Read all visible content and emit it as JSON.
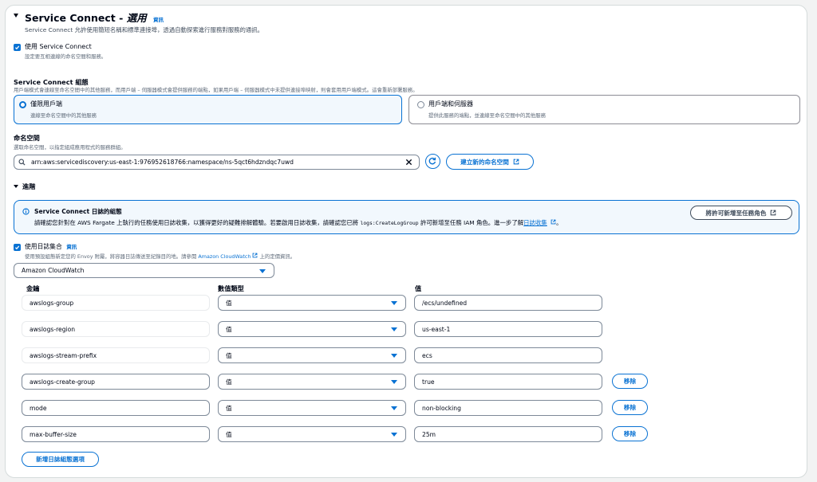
{
  "service_connect": {
    "title": "Service Connect - ",
    "title_italic": "選用",
    "info": "資訊",
    "description": "Service Connect 允許使用簡短名稱和標準連接埠，透過自動探索進行服務對服務的通訊。",
    "use_checkbox_label": "使用 Service Connect",
    "use_checkbox_desc": "設定要互相連線的命名空間和服務。"
  },
  "config": {
    "label": "Service Connect 組態",
    "description": "用戶端模式會連線至命名空間中的其他服務，而用戶端 – 伺服器模式會提供服務的端點，如果用戶端 – 伺服器模式中未提供連接埠映射，則會套用用戶端模式。這會重新部署服務。",
    "option_client": {
      "title": "僅限用戶端",
      "desc": "連線至命名空間中的其他服務"
    },
    "option_client_server": {
      "title": "用戶端和伺服器",
      "desc": "提供此服務的端點，並連線至命名空間中的其他服務"
    }
  },
  "namespace": {
    "label": "命名空間",
    "description": "選取命名空間，以指定組成應用程式的服務群組。",
    "value": "arn:aws:servicediscovery:us-east-1:976952618766:namespace/ns-5qct6hdzndqc7uwd",
    "create_button": "建立新的命名空間"
  },
  "advanced": {
    "label": "進階",
    "alert_title": "Service Connect 日誌的組態",
    "alert_text_1": "請確認您針對在 AWS Fargate 上執行的任務使用日誌收集，以獲得更好的疑難排解體驗。若要啟用日誌收集，請確認您已將 ",
    "alert_code": "logs:CreateLogGroup",
    "alert_text_2": " 許可新增至任務 IAM 角色。進一步了解",
    "alert_link": "日誌收集",
    "alert_end": "。",
    "alert_button": "將許可新增至任務角色"
  },
  "log_collection": {
    "checkbox_label": "使用日誌集合",
    "info": "資訊",
    "description_1": "使用預設組態新定您的 Envoy 附屬，將容器日誌傳送至紀錄目的地。請參閱 ",
    "description_link": "Amazon CloudWatch",
    "description_2": " 上的定價資訊。",
    "driver": "Amazon CloudWatch",
    "col_key": "金鑰",
    "col_type": "數值類型",
    "col_value": "值",
    "remove_label": "移除",
    "add_button": "新增日誌組態選項",
    "rows": [
      {
        "key": "awslogs-group",
        "type": "值",
        "value": "/ecs/undefined"
      },
      {
        "key": "awslogs-region",
        "type": "值",
        "value": "us-east-1"
      },
      {
        "key": "awslogs-stream-prefix",
        "type": "值",
        "value": "ecs"
      },
      {
        "key": "awslogs-create-group",
        "type": "值",
        "value": "true"
      },
      {
        "key": "mode",
        "type": "值",
        "value": "non-blocking"
      },
      {
        "key": "max-buffer-size",
        "type": "值",
        "value": "25m"
      }
    ]
  },
  "colors": {
    "accent": "#0972d3",
    "text": "#000716",
    "muted": "#5f6b7a"
  }
}
